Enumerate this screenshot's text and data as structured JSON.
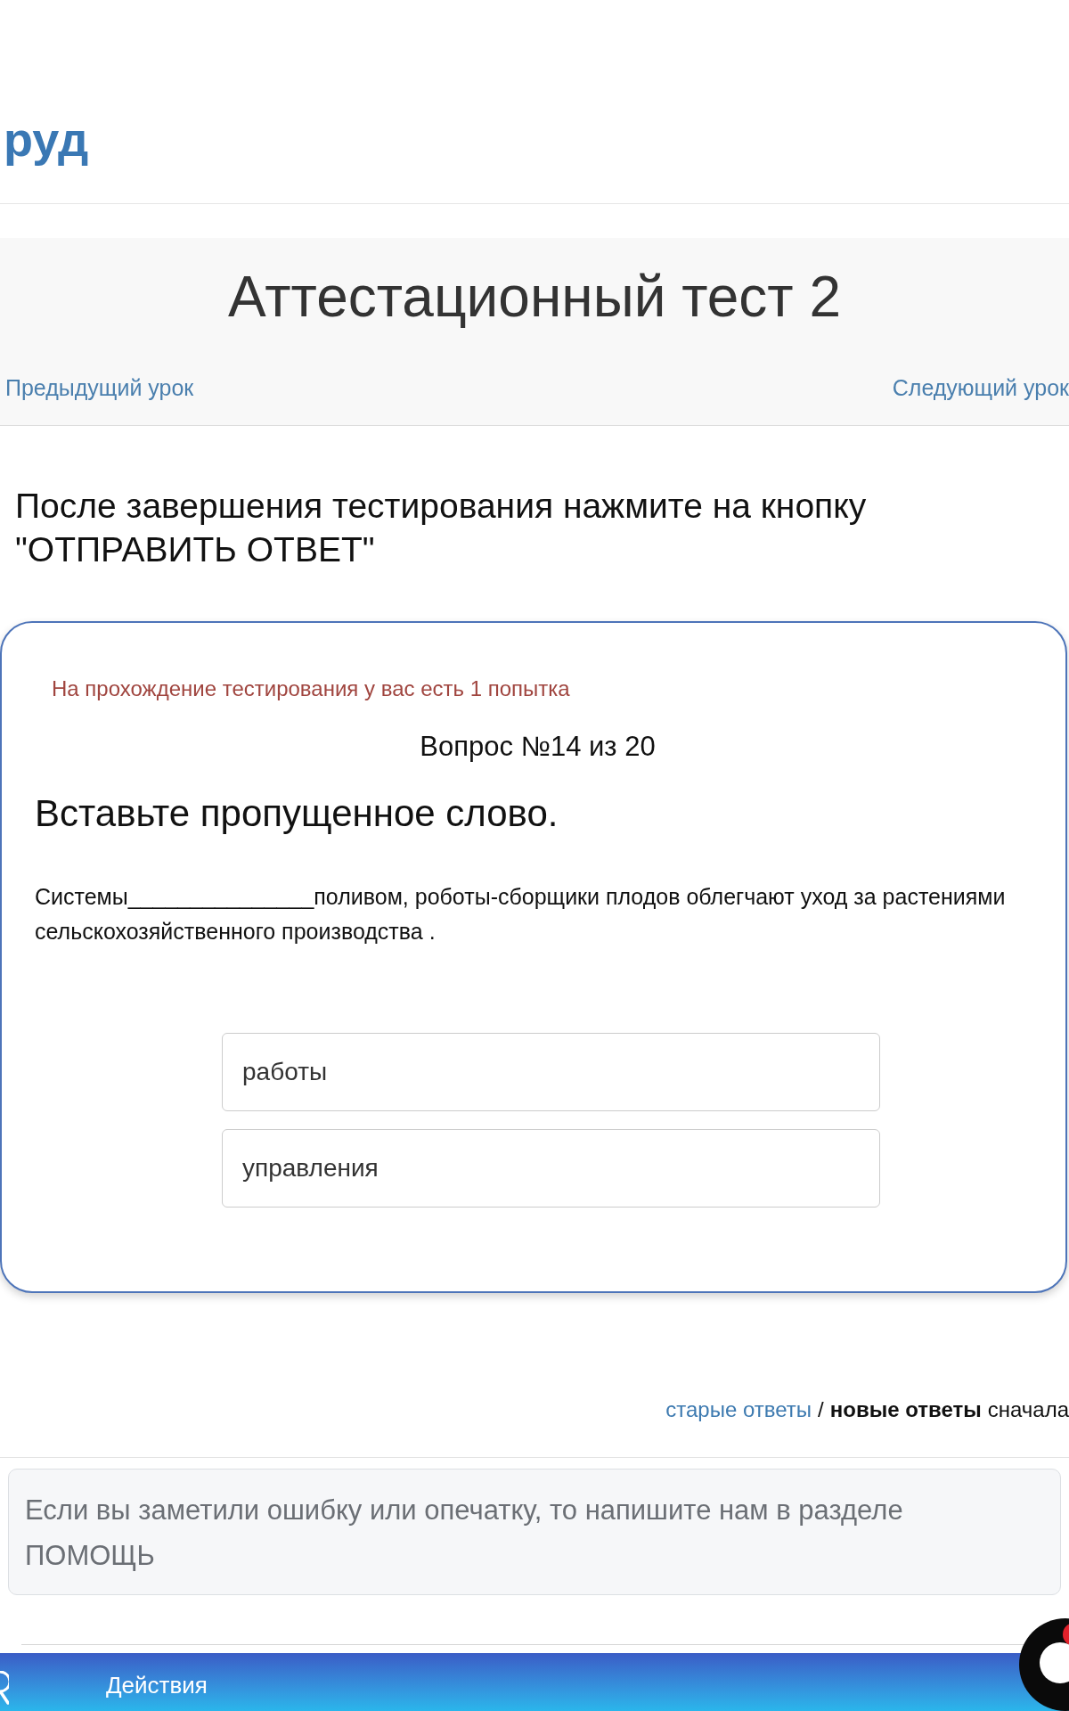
{
  "header": {
    "logo": "руд"
  },
  "lesson": {
    "title": "Аттестационный тест 2",
    "prev_link": "Предыдущий урок",
    "next_link": "Следующий урок"
  },
  "instruction": "После завершения тестирования нажмите на кнопку \"ОТПРАВИТЬ ОТВЕТ\"",
  "quiz": {
    "attempts_note": "На прохождение тестирования у вас есть 1 попытка",
    "counter": "Вопрос №14 из 20",
    "prompt": "Вставьте пропущенное слово.",
    "question": "Системы_______________поливом, роботы-сборщики плодов облегчают уход за растениями сельскохозяйственного производства .",
    "options": [
      {
        "label": "работы",
        "selected": false
      },
      {
        "label": "управления",
        "selected": false
      }
    ]
  },
  "answers_sort": {
    "options": [
      {
        "label": "старые ответы",
        "selected": false
      },
      {
        "label": "новые ответы",
        "selected": true
      }
    ],
    "separator": "/",
    "suffix": "сначала"
  },
  "feedback": {
    "placeholder": "Если вы заметили ошибку или опечатку, то напишите нам в разделе ПОМОЩЬ"
  },
  "bottom_bar": {
    "label": "Действия"
  },
  "chat": {
    "unread": true
  }
}
